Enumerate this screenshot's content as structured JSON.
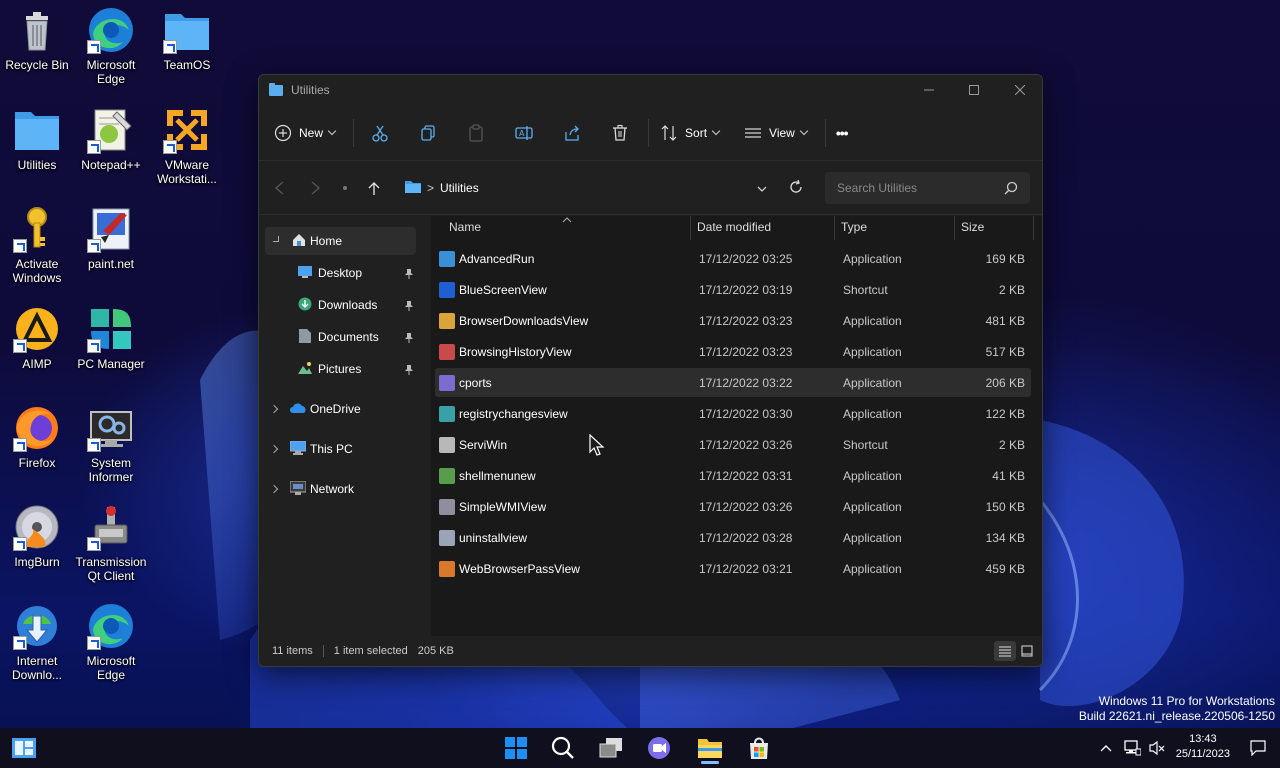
{
  "desktop": {
    "icons": [
      {
        "label": "Recycle Bin",
        "icon": "recycle-bin-icon"
      },
      {
        "label": "Microsoft Edge",
        "icon": "edge-icon"
      },
      {
        "label": "TeamOS",
        "icon": "folder-icon"
      },
      {
        "label": "Utilities",
        "icon": "folder-icon"
      },
      {
        "label": "Notepad++",
        "icon": "notepadpp-icon"
      },
      {
        "label": "VMware Workstati...",
        "icon": "vmware-icon"
      },
      {
        "label": "Activate Windows",
        "icon": "key-icon"
      },
      {
        "label": "paint.net",
        "icon": "paintnet-icon"
      },
      {
        "label": "AIMP",
        "icon": "aimp-icon"
      },
      {
        "label": "PC Manager",
        "icon": "pc-manager-icon"
      },
      {
        "label": "Firefox",
        "icon": "firefox-icon"
      },
      {
        "label": "System Informer",
        "icon": "system-informer-icon"
      },
      {
        "label": "ImgBurn",
        "icon": "imgburn-icon"
      },
      {
        "label": "Transmission Qt Client",
        "icon": "transmission-icon"
      },
      {
        "label": "Internet Downlo...",
        "icon": "idm-icon"
      },
      {
        "label": "Microsoft Edge",
        "icon": "edge-icon"
      }
    ]
  },
  "window": {
    "title": "Utilities",
    "toolbar": {
      "new_label": "New",
      "sort_label": "Sort",
      "view_label": "View",
      "more_label": "•••"
    },
    "address": {
      "path_sep": ">",
      "folder": "Utilities",
      "search_placeholder": "Search Utilities"
    },
    "sidebar": {
      "home": "Home",
      "desktop": "Desktop",
      "downloads": "Downloads",
      "documents": "Documents",
      "pictures": "Pictures",
      "onedrive": "OneDrive",
      "thispc": "This PC",
      "network": "Network"
    },
    "columns": {
      "name": "Name",
      "date": "Date modified",
      "type": "Type",
      "size": "Size"
    },
    "files": [
      {
        "name": "AdvancedRun",
        "date": "17/12/2022 03:25",
        "type": "Application",
        "size": "169 KB",
        "color": "#3b8fd6"
      },
      {
        "name": "BlueScreenView",
        "date": "17/12/2022 03:19",
        "type": "Shortcut",
        "size": "2 KB",
        "color": "#1f5fd1"
      },
      {
        "name": "BrowserDownloadsView",
        "date": "17/12/2022 03:23",
        "type": "Application",
        "size": "481 KB",
        "color": "#d9a53a"
      },
      {
        "name": "BrowsingHistoryView",
        "date": "17/12/2022 03:23",
        "type": "Application",
        "size": "517 KB",
        "color": "#c94a4a"
      },
      {
        "name": "cports",
        "date": "17/12/2022 03:22",
        "type": "Application",
        "size": "206 KB",
        "color": "#7f6ad1"
      },
      {
        "name": "registrychangesview",
        "date": "17/12/2022 03:30",
        "type": "Application",
        "size": "122 KB",
        "color": "#3aa0a8"
      },
      {
        "name": "ServiWin",
        "date": "17/12/2022 03:26",
        "type": "Shortcut",
        "size": "2 KB",
        "color": "#b8b8b8"
      },
      {
        "name": "shellmenunew",
        "date": "17/12/2022 03:31",
        "type": "Application",
        "size": "41 KB",
        "color": "#5a9c4e"
      },
      {
        "name": "SimpleWMIView",
        "date": "17/12/2022 03:26",
        "type": "Application",
        "size": "150 KB",
        "color": "#8e8e9e"
      },
      {
        "name": "uninstallview",
        "date": "17/12/2022 03:28",
        "type": "Application",
        "size": "134 KB",
        "color": "#9aa4b8"
      },
      {
        "name": "WebBrowserPassView",
        "date": "17/12/2022 03:21",
        "type": "Application",
        "size": "459 KB",
        "color": "#d87a2a"
      }
    ],
    "selected_index": 4,
    "status": {
      "items": "11 items",
      "selected": "1 item selected",
      "size": "205 KB"
    }
  },
  "watermark": {
    "line1": "Windows 11 Pro for Workstations",
    "line2": "Build 22621.ni_release.220506-1250"
  },
  "taskbar": {
    "time": "13:43",
    "date": "25/11/2023"
  }
}
